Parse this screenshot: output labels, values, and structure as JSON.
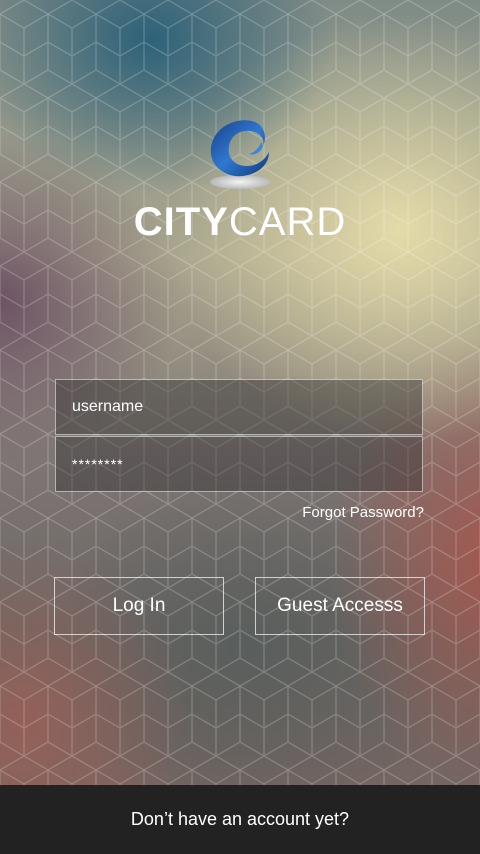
{
  "brand": {
    "logo_bold": "CITY",
    "logo_light": "CARD",
    "accent_color": "#2b6cc4"
  },
  "login_form": {
    "username_value": "username",
    "password_value": "********",
    "forgot_label": "Forgot Password?"
  },
  "actions": {
    "login_label": "Log In",
    "guest_label": "Guest Accesss"
  },
  "footer": {
    "signup_prompt": "Don’t have an account yet?"
  }
}
